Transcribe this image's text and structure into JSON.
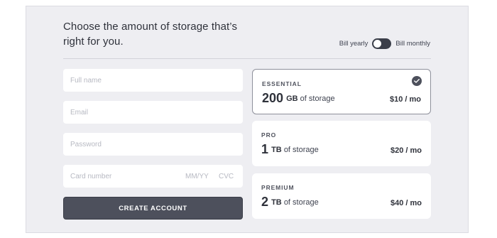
{
  "heading": "Choose the amount of storage that’s right for you.",
  "billing": {
    "yearly_label": "Bill yearly",
    "monthly_label": "Bill monthly",
    "toggle_state": "yearly"
  },
  "form": {
    "full_name_placeholder": "Full name",
    "email_placeholder": "Email",
    "password_placeholder": "Password",
    "card_number_placeholder": "Card number",
    "expiry_placeholder": "MM/YY",
    "cvc_placeholder": "CVC",
    "submit_label": "CREATE ACCOUNT"
  },
  "plans": [
    {
      "name": "ESSENTIAL",
      "amount": "200",
      "unit": "GB",
      "suffix": "of storage",
      "price": "$10 / mo",
      "selected": true
    },
    {
      "name": "PRO",
      "amount": "1",
      "unit": "TB",
      "suffix": "of storage",
      "price": "$20 / mo",
      "selected": false
    },
    {
      "name": "PREMIUM",
      "amount": "2",
      "unit": "TB",
      "suffix": "of storage",
      "price": "$40 / mo",
      "selected": false
    }
  ],
  "icons": {
    "selected_indicator": "check-circle-icon"
  },
  "colors": {
    "button": "#4d505c",
    "background": "#eeeef2",
    "card": "#ffffff"
  }
}
